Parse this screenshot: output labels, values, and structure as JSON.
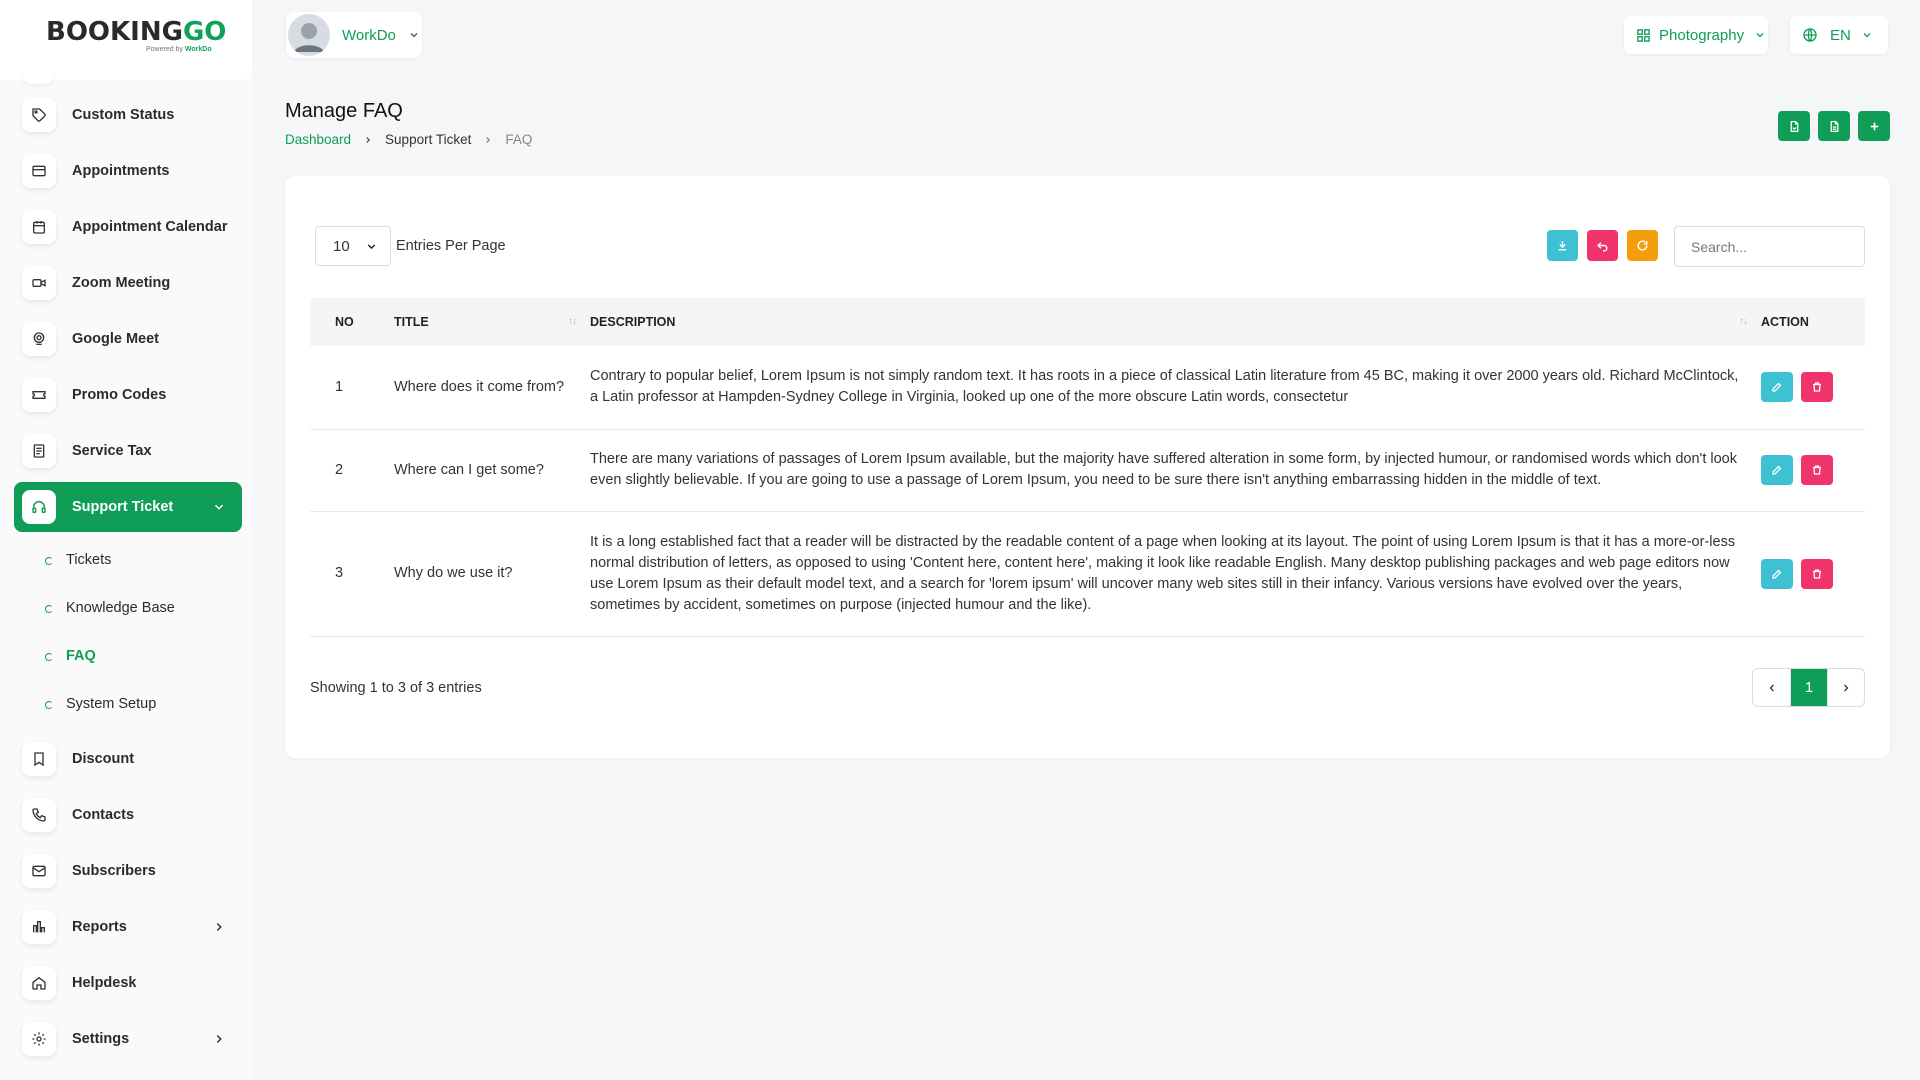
{
  "brand": {
    "logo_main": "BOOKING",
    "logo_accent": "GO",
    "powered_prefix": "Powered by",
    "powered_name": "WorkDo"
  },
  "sidebar": {
    "items": [
      {
        "label": "Custom Status",
        "icon": "tag-icon"
      },
      {
        "label": "Appointments",
        "icon": "card-icon"
      },
      {
        "label": "Appointment Calendar",
        "icon": "calendar-icon"
      },
      {
        "label": "Zoom Meeting",
        "icon": "video-icon"
      },
      {
        "label": "Google Meet",
        "icon": "webcam-icon"
      },
      {
        "label": "Promo Codes",
        "icon": "ticket-icon"
      },
      {
        "label": "Service Tax",
        "icon": "receipt-icon"
      },
      {
        "label": "Support Ticket",
        "icon": "headset-icon",
        "active": true
      },
      {
        "label": "Discount",
        "icon": "bookmark-icon"
      },
      {
        "label": "Contacts",
        "icon": "phone-icon"
      },
      {
        "label": "Subscribers",
        "icon": "mail-icon"
      },
      {
        "label": "Reports",
        "icon": "chart-icon"
      },
      {
        "label": "Helpdesk",
        "icon": "home-icon"
      },
      {
        "label": "Settings",
        "icon": "gear-icon"
      }
    ],
    "sub_items": [
      "Tickets",
      "Knowledge Base",
      "FAQ",
      "System Setup"
    ],
    "current_sub": "FAQ"
  },
  "topbar": {
    "workspace": "WorkDo",
    "business": "Photography",
    "language": "EN"
  },
  "header": {
    "title": "Manage FAQ",
    "breadcrumb": [
      "Dashboard",
      "Support Ticket",
      "FAQ"
    ]
  },
  "table_controls": {
    "per_page_value": "10",
    "per_page_label": "Entries Per Page",
    "search_placeholder": "Search..."
  },
  "table": {
    "columns": [
      "NO",
      "TITLE",
      "DESCRIPTION",
      "ACTION"
    ],
    "rows": [
      {
        "no": "1",
        "title": "Where does it come from?",
        "description": "Contrary to popular belief, Lorem Ipsum is not simply random text. It has roots in a piece of classical Latin literature from 45 BC, making it over 2000 years old. Richard McClintock, a Latin professor at Hampden-Sydney College in Virginia, looked up one of the more obscure Latin words, consectetur"
      },
      {
        "no": "2",
        "title": "Where can I get some?",
        "description": "There are many variations of passages of Lorem Ipsum available, but the majority have suffered alteration in some form, by injected humour, or randomised words which don't look even slightly believable. If you are going to use a passage of Lorem Ipsum, you need to be sure there isn't anything embarrassing hidden in the middle of text."
      },
      {
        "no": "3",
        "title": "Why do we use it?",
        "description": "It is a long established fact that a reader will be distracted by the readable content of a page when looking at its layout. The point of using Lorem Ipsum is that it has a more-or-less normal distribution of letters, as opposed to using 'Content here, content here', making it look like readable English. Many desktop publishing packages and web page editors now use Lorem Ipsum as their default model text, and a search for 'lorem ipsum' will uncover many web sites still in their infancy. Various versions have evolved over the years, sometimes by accident, sometimes on purpose (injected humour and the like)."
      }
    ]
  },
  "footer": {
    "showing": "Showing 1 to 3 of 3 entries",
    "current_page": "1"
  },
  "colors": {
    "brand_green": "#0f9d58",
    "edit_cyan": "#3ec1d3",
    "delete_pink": "#f0336b",
    "refresh_orange": "#f59e0b"
  }
}
